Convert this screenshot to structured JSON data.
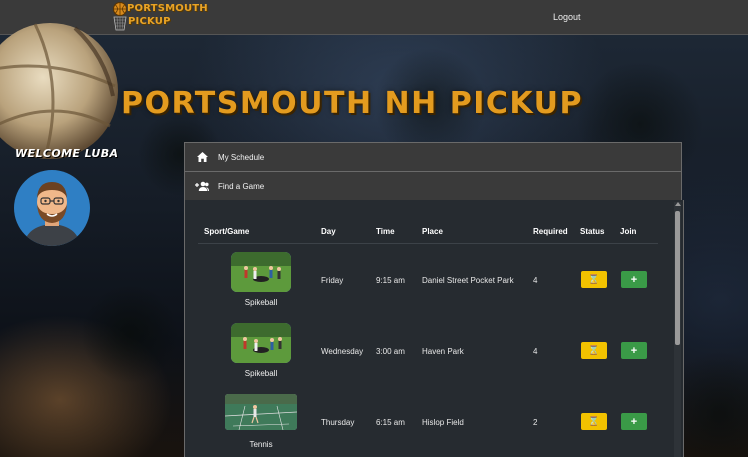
{
  "nav": {
    "logo_line1": "PORTSMOUTH",
    "logo_line2": "PICKUP",
    "logout_label": "Logout"
  },
  "hero": {
    "title": "PORTSMOUTH NH PICKUP"
  },
  "user": {
    "welcome": "WELCOME LUBA"
  },
  "menu": [
    {
      "label": "My Schedule",
      "icon": "home-icon"
    },
    {
      "label": "Find a Game",
      "icon": "group-add-icon"
    }
  ],
  "table": {
    "headers": {
      "sport": "Sport/Game",
      "day": "Day",
      "time": "Time",
      "place": "Place",
      "required": "Required",
      "status": "Status",
      "join": "Join"
    },
    "rows": [
      {
        "sport": "Spikeball",
        "day": "Friday",
        "time": "9:15 am",
        "place": "Daniel Street Pocket Park",
        "required": "4",
        "status_icon": "hourglass-icon",
        "join_label": "+"
      },
      {
        "sport": "Spikeball",
        "day": "Wednesday",
        "time": "3:00 am",
        "place": "Haven Park",
        "required": "4",
        "status_icon": "hourglass-icon",
        "join_label": "+"
      },
      {
        "sport": "Tennis",
        "day": "Thursday",
        "time": "6:15 am",
        "place": "Hislop Field",
        "required": "2",
        "status_icon": "hourglass-icon",
        "join_label": "+"
      }
    ]
  },
  "colors": {
    "accent_orange": "#e39b1f",
    "status_yellow": "#f2c200",
    "join_green": "#3a9a47",
    "topbar": "#3a3a3a",
    "table_bg": "#262b30"
  }
}
